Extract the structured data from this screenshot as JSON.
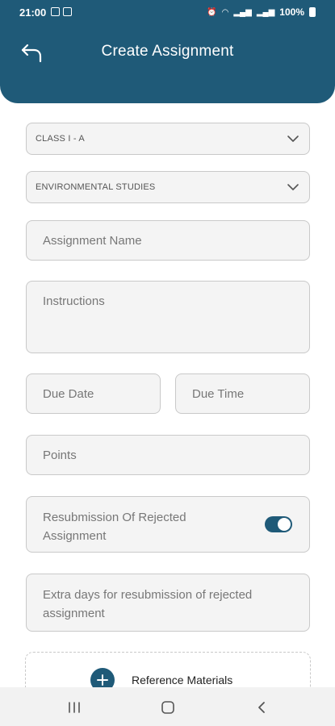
{
  "status_bar": {
    "time": "21:00",
    "battery_text": "100%"
  },
  "header": {
    "title": "Create Assignment",
    "back_icon": "back-arrow-icon"
  },
  "form": {
    "class_select": {
      "value": "CLASS I - A"
    },
    "subject_select": {
      "value": "ENVIRONMENTAL STUDIES"
    },
    "assignment_name": {
      "placeholder": "Assignment Name"
    },
    "instructions": {
      "placeholder": "Instructions"
    },
    "due_date": {
      "placeholder": "Due Date"
    },
    "due_time": {
      "placeholder": "Due Time"
    },
    "points": {
      "placeholder": "Points"
    },
    "resubmission": {
      "label": "Resubmission Of Rejected Assignment",
      "enabled": true
    },
    "extra_days": {
      "placeholder": "Extra days for resubmission of rejected assignment"
    },
    "reference_materials": {
      "label": "Reference Materials",
      "icon": "plus-icon"
    }
  },
  "colors": {
    "brand": "#1f5a78",
    "field_bg": "#f4f4f4",
    "field_border": "#c9c9c9"
  }
}
